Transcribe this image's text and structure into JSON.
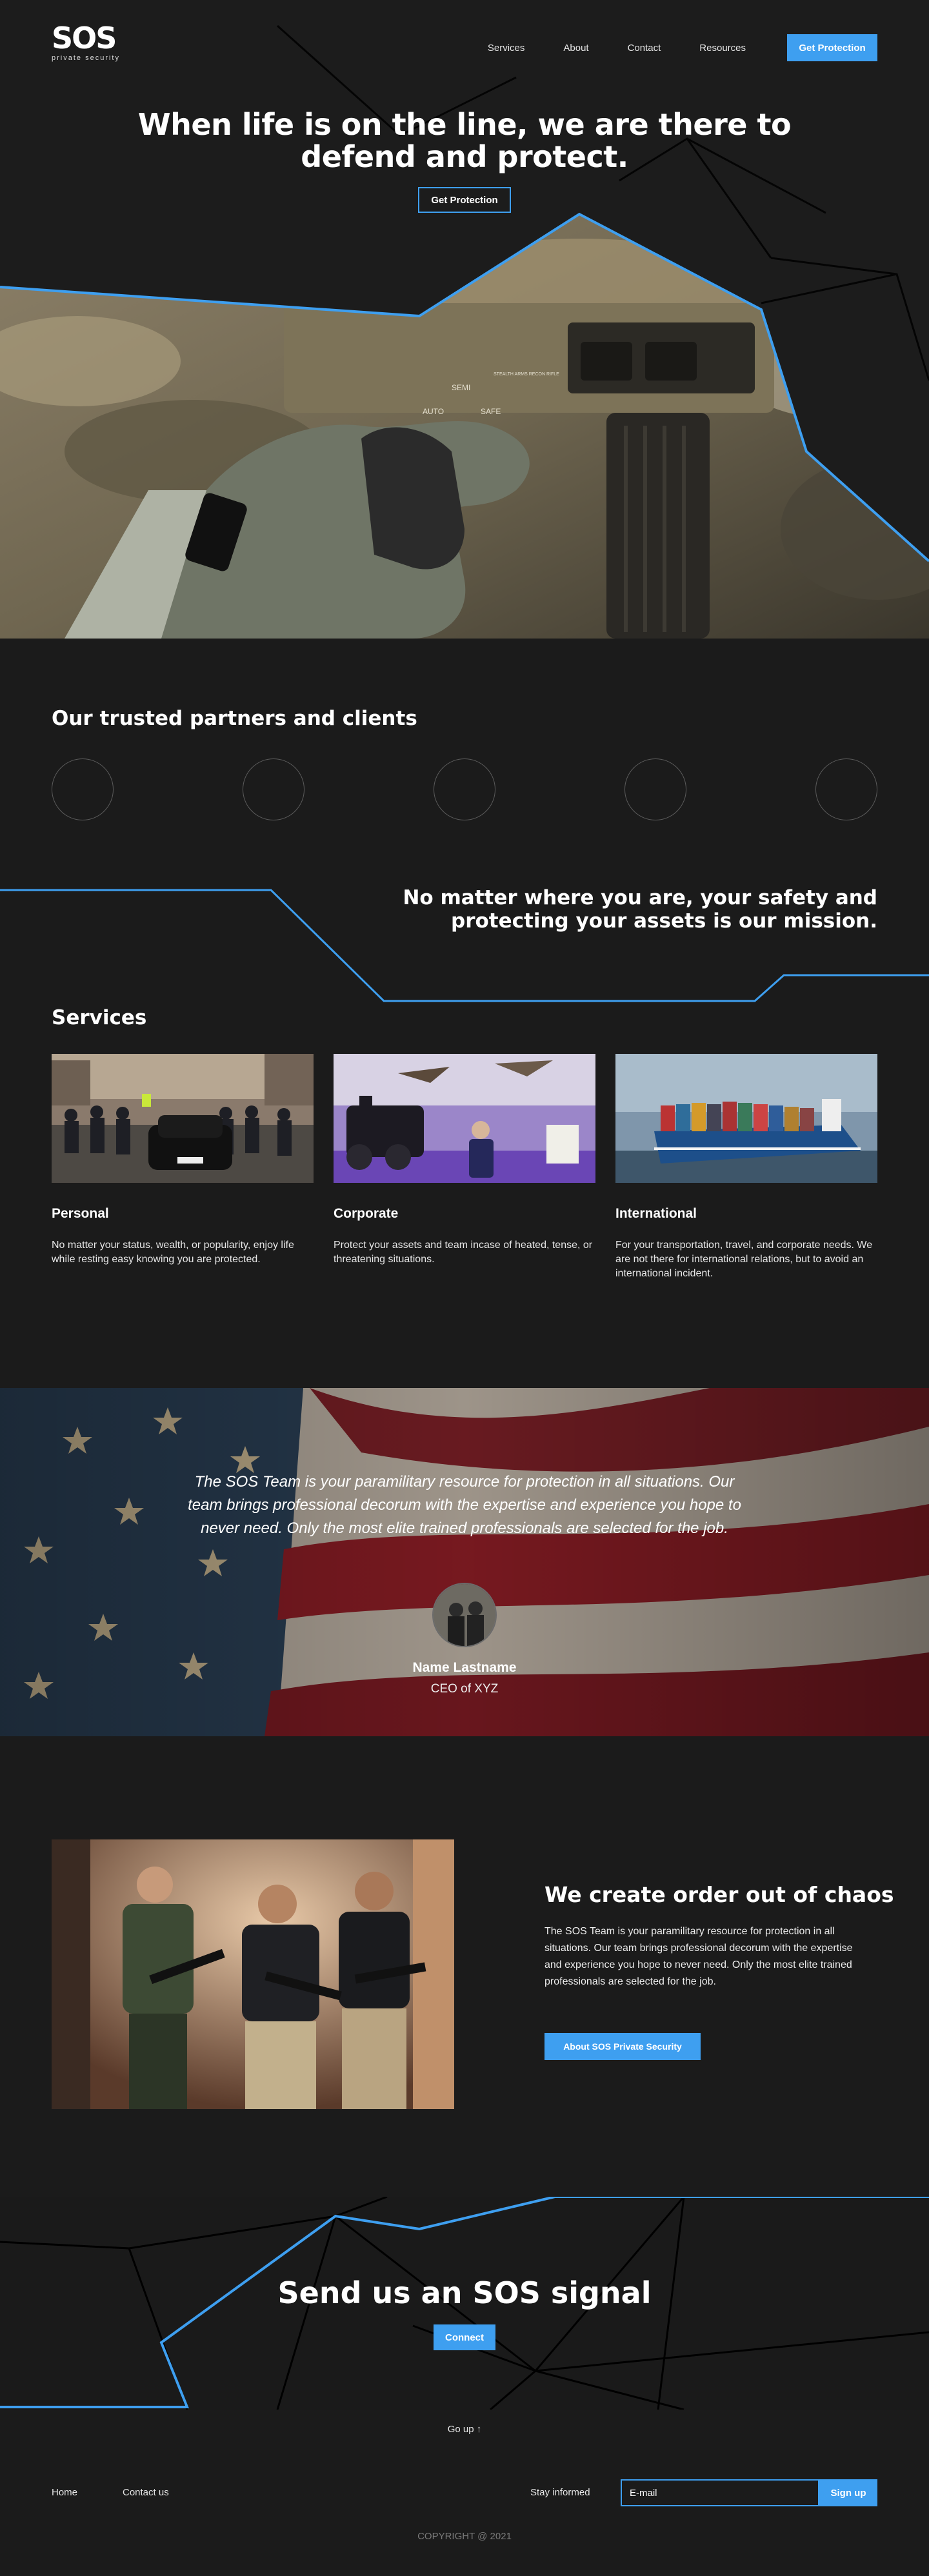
{
  "brand": {
    "name": "SOS",
    "tagline": "private security"
  },
  "nav": {
    "items": [
      "Services",
      "About",
      "Contact",
      "Resources"
    ],
    "cta_label": "Get Protection"
  },
  "hero": {
    "title_line1": "When life is on the line, we are there to",
    "title_line2": "defend and protect.",
    "button_label": "Get Protection",
    "rifle_markings": {
      "auto": "AUTO",
      "safe": "SAFE",
      "semi": "SEMI",
      "receiver": "STEALTH ARMS RECON RIFLE"
    }
  },
  "partners": {
    "title": "Our trusted partners and clients",
    "count": 5
  },
  "mission": {
    "line1": "No matter where you are, your safety and",
    "line2": "protecting your assets is our mission."
  },
  "services": {
    "title": "Services",
    "items": [
      {
        "title": "Personal",
        "desc": "No matter your status, wealth, or popularity, enjoy life while resting easy knowing you are protected."
      },
      {
        "title": "Corporate",
        "desc": "Protect your assets and team incase of heated, tense, or threatening situations."
      },
      {
        "title": "International",
        "desc": "For your transportation, travel, and corporate needs. We are not there for international relations, but to avoid an international incident."
      }
    ]
  },
  "testimonial": {
    "quote": "The SOS Team is your paramilitary resource for protection in all situations. Our team brings professional decorum with the expertise and experience you hope to never need. Only the most elite trained professionals are selected for the job.",
    "name": "Name Lastname",
    "role": "CEO of XYZ"
  },
  "about": {
    "title": "We create order out of chaos",
    "text": "The SOS Team is your paramilitary resource for protection in all situations. Our team brings professional decorum with the expertise and experience you hope to never need. Only the most elite trained professionals are selected for the job.",
    "button_label": "About SOS Private Security"
  },
  "cta": {
    "title": "Send us an SOS signal",
    "button_label": "Connect"
  },
  "footer": {
    "go_up": "Go up ↑",
    "links": [
      "Home",
      "Contact us"
    ],
    "stay_informed": "Stay informed",
    "email_placeholder": "E-mail",
    "signup_label": "Sign up",
    "copyright": "COPYRIGHT @ 2021"
  },
  "colors": {
    "accent": "#3e9ff0",
    "background": "#1b1b1b",
    "text": "#ffffff"
  }
}
